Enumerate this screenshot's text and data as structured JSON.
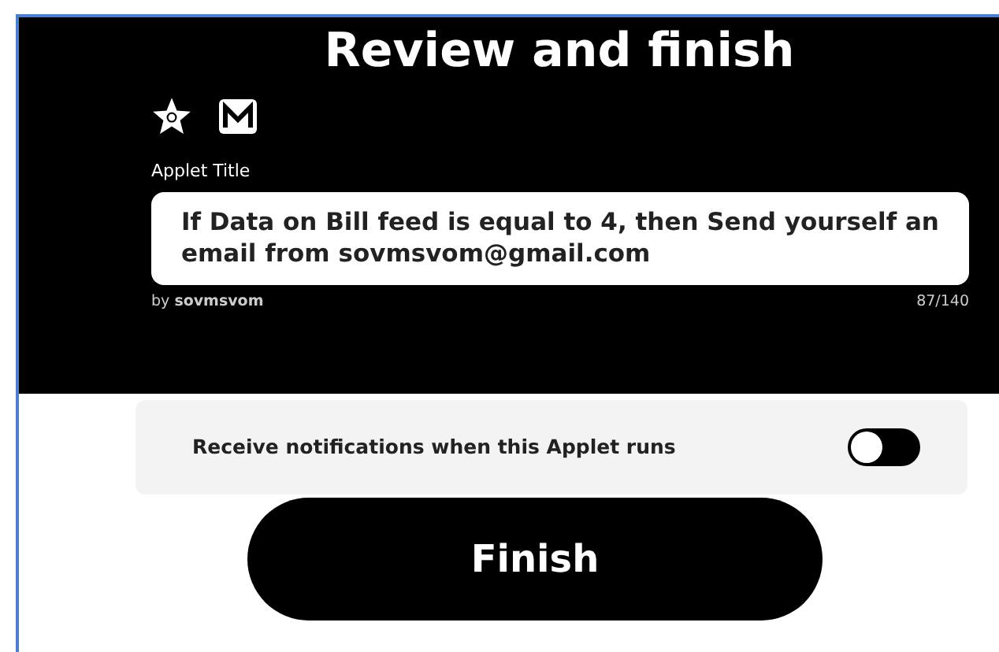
{
  "header": {
    "title": "Review and finish"
  },
  "applet_title": {
    "label": "Applet Title",
    "value": "If Data on Bill feed is equal to 4, then Send yourself an email from sovmsvom@gmail.com",
    "author": "by **sovmsvom**",
    "count": "87/140"
  },
  "notifications": {
    "label": "Receive notifications when this Applet runs",
    "on": false
  },
  "finish_button": {
    "label": "Finish"
  }
}
